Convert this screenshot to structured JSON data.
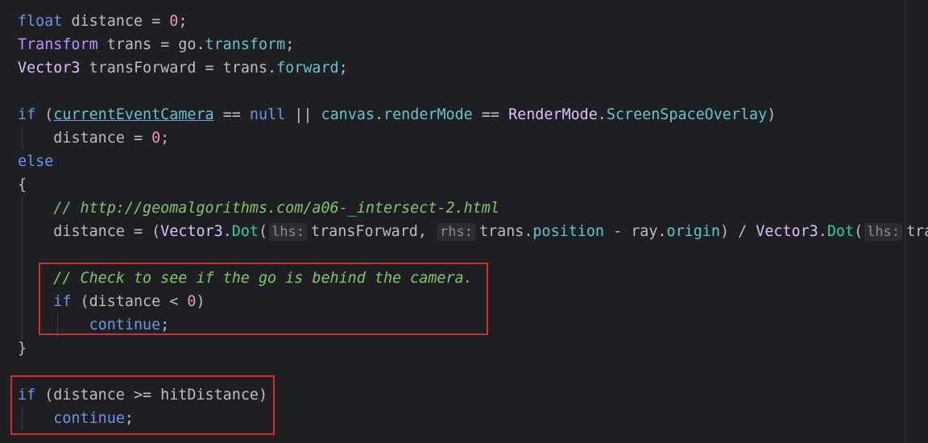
{
  "code": {
    "l1": {
      "kw": "float",
      "rest": " distance = ",
      "num": "0",
      "end": ";"
    },
    "l2": {
      "type": "Transform",
      "mid": " trans = go.",
      "prop": "transform",
      "end": ";"
    },
    "l3": {
      "struct": "Vector3",
      "mid": " transForward = trans.",
      "prop": "forward",
      "end": ";"
    },
    "l5": {
      "kw_if": "if",
      "open": " (",
      "camera": "currentEventCamera",
      "eq": " == ",
      "null": "null",
      "or": " || ",
      "canvas": "canvas",
      "dot1": ".",
      "render": "renderMode",
      "eq2": " == ",
      "rm_type": "RenderMode",
      "dot2": ".",
      "overlay": "ScreenSpaceOverlay",
      "close": ")"
    },
    "l6": {
      "indent": "    ",
      "rest": "distance = ",
      "num": "0",
      "end": ";"
    },
    "l7": {
      "kw": "else"
    },
    "l8": {
      "brace": "{"
    },
    "l9": {
      "indent": "    ",
      "comment": "// http://geomalgorithms.com/a06-_intersect-2.html"
    },
    "l10": {
      "indent": "    ",
      "a": "distance = (",
      "v1": "Vector3",
      "dot1": ".",
      "fn1": "Dot",
      "p1": "(",
      "hint1": "lhs:",
      "arg1": "transForward, ",
      "hint2": "rhs:",
      "arg2a": "trans.",
      "pos": "position",
      "minus": " - ray.",
      "origin": "origin",
      "div": ") / ",
      "v2": "Vector3",
      "dot2": ".",
      "fn2": "Dot",
      "p2": "(",
      "hint3": "lhs:",
      "arg3": "transF"
    },
    "l12": {
      "indent": "    ",
      "comment": "// Check to see if the go is behind the camera."
    },
    "l13": {
      "indent": "    ",
      "kw": "if",
      "rest": " (distance < ",
      "num": "0",
      "end": ")"
    },
    "l14": {
      "indent": "        ",
      "kw": "continue",
      "end": ";"
    },
    "l15": {
      "brace": "}"
    },
    "l17": {
      "kw": "if",
      "rest": " (distance >= hitDistance)"
    },
    "l18": {
      "indent": "    ",
      "kw": "continue",
      "end": ";"
    }
  },
  "colors": {
    "background": "#1e1f22",
    "keyword": "#6c95eb",
    "type": "#c191ff",
    "struct": "#e1bfff",
    "number": "#ed94c0",
    "method": "#39cc9b",
    "property": "#66c3cc",
    "comment": "#85c46c",
    "highlight_box": "#d92a2a"
  }
}
